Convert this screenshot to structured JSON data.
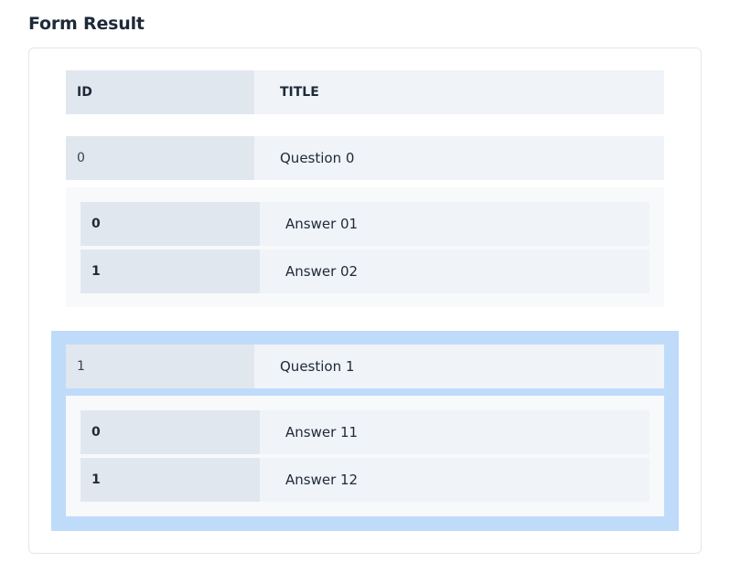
{
  "page": {
    "title": "Form Result"
  },
  "table": {
    "headers": {
      "id": "ID",
      "title": "TITLE"
    },
    "questions": [
      {
        "id": "0",
        "title": "Question 0",
        "answers": [
          {
            "id": "0",
            "title": "Answer 01"
          },
          {
            "id": "1",
            "title": "Answer 02"
          }
        ]
      },
      {
        "id": "1",
        "title": "Question 1",
        "highlighted": true,
        "answers": [
          {
            "id": "0",
            "title": "Answer 11"
          },
          {
            "id": "1",
            "title": "Answer 12"
          }
        ]
      }
    ]
  },
  "colors": {
    "highlight": "#bfdbfa",
    "id_cell": "#e1e7ef",
    "title_cell": "#f0f3f8"
  }
}
